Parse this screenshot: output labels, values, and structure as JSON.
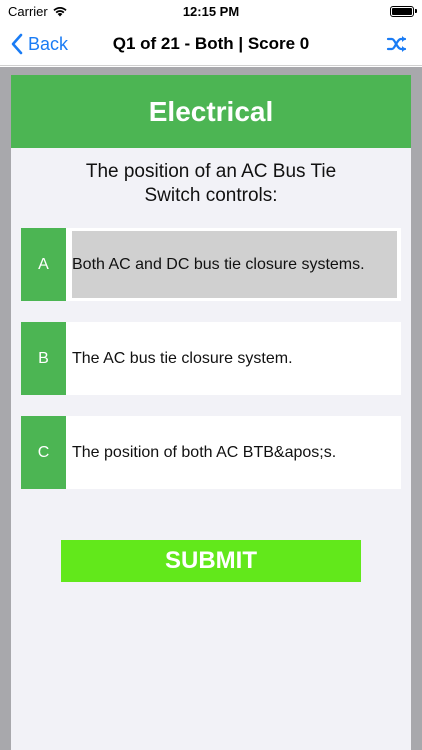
{
  "status_bar": {
    "carrier": "Carrier",
    "time": "12:15 PM"
  },
  "nav": {
    "back_label": "Back",
    "title": "Q1 of 21 - Both | Score 0"
  },
  "card": {
    "category": "Electrical",
    "question": "The position of an AC Bus Tie Switch controls:",
    "options": [
      {
        "letter": "A",
        "text": "Both AC and DC bus tie closure systems.",
        "selected": true
      },
      {
        "letter": "B",
        "text": "The AC bus tie closure system.",
        "selected": false
      },
      {
        "letter": "C",
        "text": "The position of both AC BTB&apos;s.",
        "selected": false
      }
    ],
    "submit_label": "SUBMIT"
  },
  "colors": {
    "green": "#4cb553",
    "submit_green": "#62e81b",
    "accent_blue": "#1a7cf5"
  }
}
